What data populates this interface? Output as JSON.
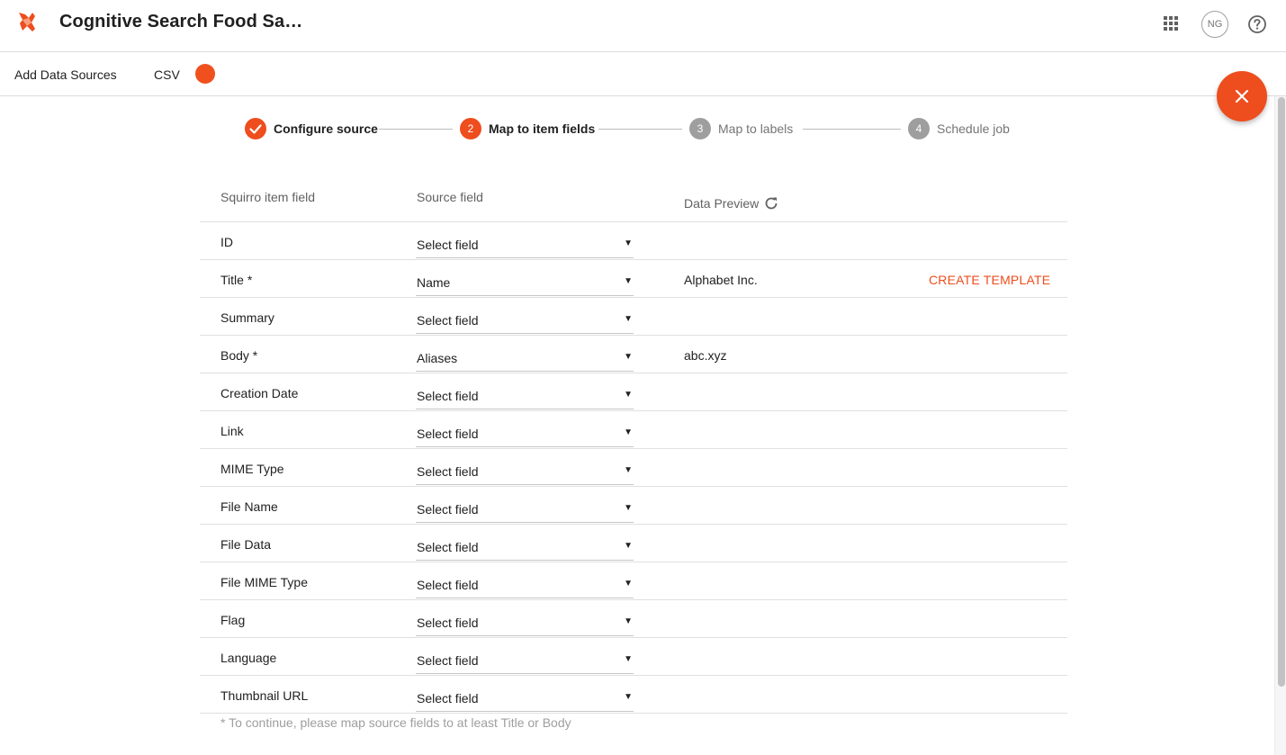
{
  "app": {
    "title": "Cognitive Search Food Sa…",
    "avatar_initials": "NG",
    "brand_color": "#ee4d1e"
  },
  "subheader": {
    "title": "Add Data Sources",
    "source_type": "CSV"
  },
  "stepper": {
    "steps": [
      {
        "index": "1",
        "label": "Configure source",
        "state": "done"
      },
      {
        "index": "2",
        "label": "Map to item fields",
        "state": "active"
      },
      {
        "index": "3",
        "label": "Map to labels",
        "state": "pending"
      },
      {
        "index": "4",
        "label": "Schedule job",
        "state": "pending"
      }
    ]
  },
  "table": {
    "headers": {
      "item_field": "Squirro item field",
      "source_field": "Source field",
      "preview": "Data Preview"
    },
    "rows": [
      {
        "field": "ID",
        "source": "Select field",
        "preview": "",
        "action": ""
      },
      {
        "field": "Title *",
        "source": "Name",
        "preview": "Alphabet Inc.",
        "action": "CREATE TEMPLATE"
      },
      {
        "field": "Summary",
        "source": "Select field",
        "preview": "",
        "action": ""
      },
      {
        "field": "Body *",
        "source": "Aliases",
        "preview": "abc.xyz",
        "action": ""
      },
      {
        "field": "Creation Date",
        "source": "Select field",
        "preview": "",
        "action": ""
      },
      {
        "field": "Link",
        "source": "Select field",
        "preview": "",
        "action": ""
      },
      {
        "field": "MIME Type",
        "source": "Select field",
        "preview": "",
        "action": ""
      },
      {
        "field": "File Name",
        "source": "Select field",
        "preview": "",
        "action": ""
      },
      {
        "field": "File Data",
        "source": "Select field",
        "preview": "",
        "action": ""
      },
      {
        "field": "File MIME Type",
        "source": "Select field",
        "preview": "",
        "action": ""
      },
      {
        "field": "Flag",
        "source": "Select field",
        "preview": "",
        "action": ""
      },
      {
        "field": "Language",
        "source": "Select field",
        "preview": "",
        "action": ""
      },
      {
        "field": "Thumbnail URL",
        "source": "Select field",
        "preview": "",
        "action": ""
      }
    ],
    "footnote": "* To continue, please map source fields to at least Title or Body"
  },
  "icons": {
    "logo": "squirrel-logo-icon",
    "apps": "apps-grid-icon",
    "help": "help-circle-icon",
    "close": "close-icon",
    "refresh": "refresh-icon",
    "check": "check-icon",
    "caret": "caret-down-icon"
  },
  "colors": {
    "accent": "#ee4d1e",
    "step_pending": "#9e9e9e"
  }
}
